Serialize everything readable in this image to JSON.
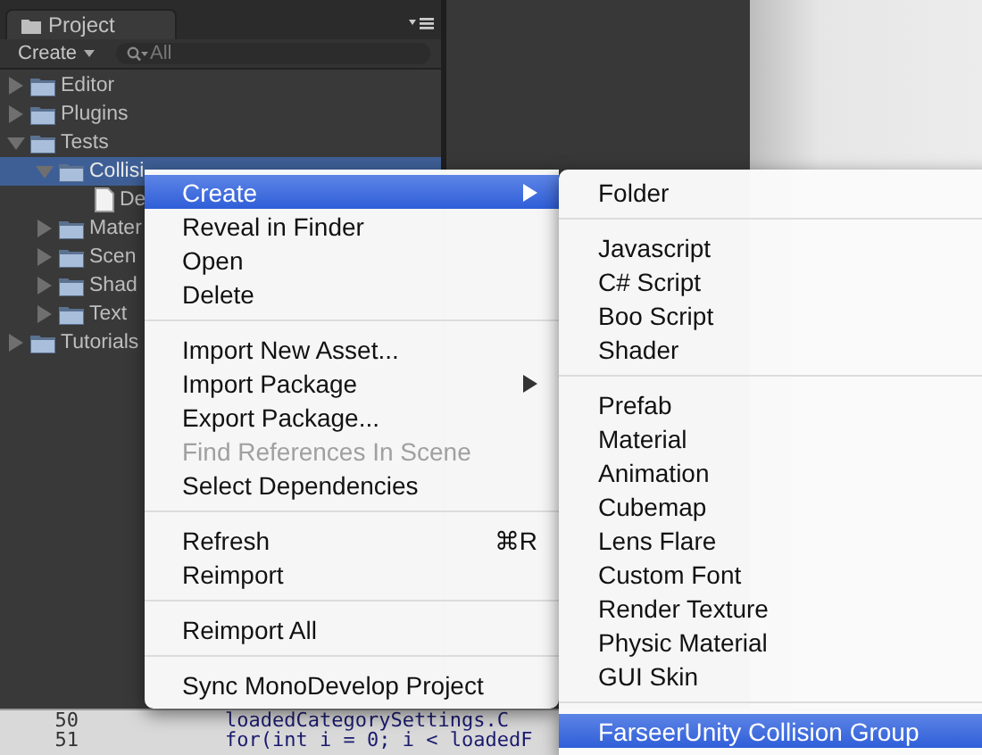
{
  "panel": {
    "title": "Project",
    "create_button": "Create",
    "search_placeholder": "All"
  },
  "tree": [
    {
      "kind": "folder",
      "label": "Editor",
      "expanded": false,
      "selected": false
    },
    {
      "kind": "folder",
      "label": "Plugins",
      "expanded": false,
      "selected": false
    },
    {
      "kind": "folder",
      "label": "Tests",
      "expanded": true,
      "selected": false,
      "children": [
        {
          "kind": "folder",
          "label": "Collisi",
          "expanded": true,
          "selected": true,
          "children": [
            {
              "kind": "file",
              "label": "De",
              "selected": false
            }
          ]
        },
        {
          "kind": "folder",
          "label": "Mater",
          "expanded": false,
          "selected": false
        },
        {
          "kind": "folder",
          "label": "Scen",
          "expanded": false,
          "selected": false
        },
        {
          "kind": "folder",
          "label": "Shad",
          "expanded": false,
          "selected": false
        },
        {
          "kind": "folder",
          "label": "Text",
          "expanded": false,
          "selected": false
        }
      ]
    },
    {
      "kind": "folder",
      "label": "Tutorials",
      "expanded": false,
      "selected": false
    }
  ],
  "context_menu": [
    {
      "kind": "item",
      "label": "Create",
      "selected": true,
      "disabled": false,
      "submenu": true
    },
    {
      "kind": "item",
      "label": "Reveal in Finder",
      "selected": false,
      "disabled": false,
      "submenu": false
    },
    {
      "kind": "item",
      "label": "Open",
      "selected": false,
      "disabled": false,
      "submenu": false
    },
    {
      "kind": "item",
      "label": "Delete",
      "selected": false,
      "disabled": false,
      "submenu": false
    },
    {
      "kind": "separator"
    },
    {
      "kind": "item",
      "label": "Import New Asset...",
      "selected": false,
      "disabled": false,
      "submenu": false
    },
    {
      "kind": "item",
      "label": "Import Package",
      "selected": false,
      "disabled": false,
      "submenu": true
    },
    {
      "kind": "item",
      "label": "Export Package...",
      "selected": false,
      "disabled": false,
      "submenu": false
    },
    {
      "kind": "item",
      "label": "Find References In Scene",
      "selected": false,
      "disabled": true,
      "submenu": false
    },
    {
      "kind": "item",
      "label": "Select Dependencies",
      "selected": false,
      "disabled": false,
      "submenu": false
    },
    {
      "kind": "separator"
    },
    {
      "kind": "item",
      "label": "Refresh",
      "selected": false,
      "disabled": false,
      "submenu": false,
      "shortcut": "⌘R"
    },
    {
      "kind": "item",
      "label": "Reimport",
      "selected": false,
      "disabled": false,
      "submenu": false
    },
    {
      "kind": "separator"
    },
    {
      "kind": "item",
      "label": "Reimport All",
      "selected": false,
      "disabled": false,
      "submenu": false
    },
    {
      "kind": "separator"
    },
    {
      "kind": "item",
      "label": "Sync MonoDevelop Project",
      "selected": false,
      "disabled": false,
      "submenu": false
    }
  ],
  "create_submenu": [
    {
      "kind": "item",
      "label": "Folder",
      "selected": false
    },
    {
      "kind": "separator"
    },
    {
      "kind": "item",
      "label": "Javascript",
      "selected": false
    },
    {
      "kind": "item",
      "label": "C# Script",
      "selected": false
    },
    {
      "kind": "item",
      "label": "Boo Script",
      "selected": false
    },
    {
      "kind": "item",
      "label": "Shader",
      "selected": false
    },
    {
      "kind": "separator"
    },
    {
      "kind": "item",
      "label": "Prefab",
      "selected": false
    },
    {
      "kind": "item",
      "label": "Material",
      "selected": false
    },
    {
      "kind": "item",
      "label": "Animation",
      "selected": false
    },
    {
      "kind": "item",
      "label": "Cubemap",
      "selected": false
    },
    {
      "kind": "item",
      "label": "Lens Flare",
      "selected": false
    },
    {
      "kind": "item",
      "label": "Custom Font",
      "selected": false
    },
    {
      "kind": "item",
      "label": "Render Texture",
      "selected": false
    },
    {
      "kind": "item",
      "label": "Physic Material",
      "selected": false
    },
    {
      "kind": "item",
      "label": "GUI Skin",
      "selected": false
    },
    {
      "kind": "separator"
    },
    {
      "kind": "item",
      "label": "FarseerUnity Collision Group",
      "selected": true
    }
  ],
  "code_lines": [
    {
      "number": "50",
      "text": "loadedCategorySettings.C"
    },
    {
      "number": "51",
      "text": "for(int i = 0; i < loadedF"
    }
  ]
}
